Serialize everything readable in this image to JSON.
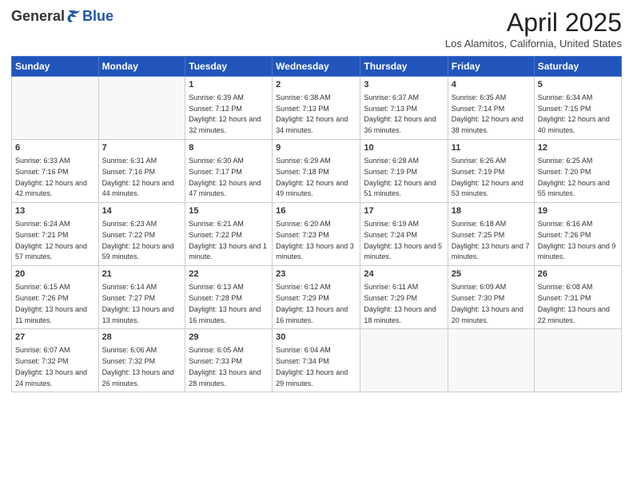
{
  "logo": {
    "general": "General",
    "blue": "Blue"
  },
  "title": "April 2025",
  "location": "Los Alamitos, California, United States",
  "weekdays": [
    "Sunday",
    "Monday",
    "Tuesday",
    "Wednesday",
    "Thursday",
    "Friday",
    "Saturday"
  ],
  "weeks": [
    [
      {
        "day": "",
        "info": ""
      },
      {
        "day": "",
        "info": ""
      },
      {
        "day": "1",
        "info": "Sunrise: 6:39 AM\nSunset: 7:12 PM\nDaylight: 12 hours and 32 minutes."
      },
      {
        "day": "2",
        "info": "Sunrise: 6:38 AM\nSunset: 7:13 PM\nDaylight: 12 hours and 34 minutes."
      },
      {
        "day": "3",
        "info": "Sunrise: 6:37 AM\nSunset: 7:13 PM\nDaylight: 12 hours and 36 minutes."
      },
      {
        "day": "4",
        "info": "Sunrise: 6:35 AM\nSunset: 7:14 PM\nDaylight: 12 hours and 38 minutes."
      },
      {
        "day": "5",
        "info": "Sunrise: 6:34 AM\nSunset: 7:15 PM\nDaylight: 12 hours and 40 minutes."
      }
    ],
    [
      {
        "day": "6",
        "info": "Sunrise: 6:33 AM\nSunset: 7:16 PM\nDaylight: 12 hours and 42 minutes."
      },
      {
        "day": "7",
        "info": "Sunrise: 6:31 AM\nSunset: 7:16 PM\nDaylight: 12 hours and 44 minutes."
      },
      {
        "day": "8",
        "info": "Sunrise: 6:30 AM\nSunset: 7:17 PM\nDaylight: 12 hours and 47 minutes."
      },
      {
        "day": "9",
        "info": "Sunrise: 6:29 AM\nSunset: 7:18 PM\nDaylight: 12 hours and 49 minutes."
      },
      {
        "day": "10",
        "info": "Sunrise: 6:28 AM\nSunset: 7:19 PM\nDaylight: 12 hours and 51 minutes."
      },
      {
        "day": "11",
        "info": "Sunrise: 6:26 AM\nSunset: 7:19 PM\nDaylight: 12 hours and 53 minutes."
      },
      {
        "day": "12",
        "info": "Sunrise: 6:25 AM\nSunset: 7:20 PM\nDaylight: 12 hours and 55 minutes."
      }
    ],
    [
      {
        "day": "13",
        "info": "Sunrise: 6:24 AM\nSunset: 7:21 PM\nDaylight: 12 hours and 57 minutes."
      },
      {
        "day": "14",
        "info": "Sunrise: 6:23 AM\nSunset: 7:22 PM\nDaylight: 12 hours and 59 minutes."
      },
      {
        "day": "15",
        "info": "Sunrise: 6:21 AM\nSunset: 7:22 PM\nDaylight: 13 hours and 1 minute."
      },
      {
        "day": "16",
        "info": "Sunrise: 6:20 AM\nSunset: 7:23 PM\nDaylight: 13 hours and 3 minutes."
      },
      {
        "day": "17",
        "info": "Sunrise: 6:19 AM\nSunset: 7:24 PM\nDaylight: 13 hours and 5 minutes."
      },
      {
        "day": "18",
        "info": "Sunrise: 6:18 AM\nSunset: 7:25 PM\nDaylight: 13 hours and 7 minutes."
      },
      {
        "day": "19",
        "info": "Sunrise: 6:16 AM\nSunset: 7:26 PM\nDaylight: 13 hours and 9 minutes."
      }
    ],
    [
      {
        "day": "20",
        "info": "Sunrise: 6:15 AM\nSunset: 7:26 PM\nDaylight: 13 hours and 11 minutes."
      },
      {
        "day": "21",
        "info": "Sunrise: 6:14 AM\nSunset: 7:27 PM\nDaylight: 13 hours and 13 minutes."
      },
      {
        "day": "22",
        "info": "Sunrise: 6:13 AM\nSunset: 7:28 PM\nDaylight: 13 hours and 16 minutes."
      },
      {
        "day": "23",
        "info": "Sunrise: 6:12 AM\nSunset: 7:29 PM\nDaylight: 13 hours and 16 minutes."
      },
      {
        "day": "24",
        "info": "Sunrise: 6:11 AM\nSunset: 7:29 PM\nDaylight: 13 hours and 18 minutes."
      },
      {
        "day": "25",
        "info": "Sunrise: 6:09 AM\nSunset: 7:30 PM\nDaylight: 13 hours and 20 minutes."
      },
      {
        "day": "26",
        "info": "Sunrise: 6:08 AM\nSunset: 7:31 PM\nDaylight: 13 hours and 22 minutes."
      }
    ],
    [
      {
        "day": "27",
        "info": "Sunrise: 6:07 AM\nSunset: 7:32 PM\nDaylight: 13 hours and 24 minutes."
      },
      {
        "day": "28",
        "info": "Sunrise: 6:06 AM\nSunset: 7:32 PM\nDaylight: 13 hours and 26 minutes."
      },
      {
        "day": "29",
        "info": "Sunrise: 6:05 AM\nSunset: 7:33 PM\nDaylight: 13 hours and 28 minutes."
      },
      {
        "day": "30",
        "info": "Sunrise: 6:04 AM\nSunset: 7:34 PM\nDaylight: 13 hours and 29 minutes."
      },
      {
        "day": "",
        "info": ""
      },
      {
        "day": "",
        "info": ""
      },
      {
        "day": "",
        "info": ""
      }
    ]
  ]
}
